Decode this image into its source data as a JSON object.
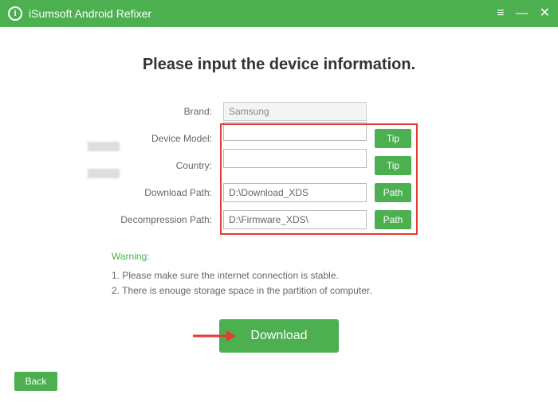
{
  "titlebar": {
    "logo_letter": "i",
    "title": "iSumsoft Android Refixer"
  },
  "heading": "Please input the device information.",
  "form": {
    "brand": {
      "label": "Brand:",
      "value": "Samsung"
    },
    "device_model": {
      "label": "Device Model:",
      "value": "",
      "tip": "Tip"
    },
    "country": {
      "label": "Country:",
      "value": "",
      "tip": "Tip"
    },
    "download_path": {
      "label": "Download Path:",
      "value": "D:\\Download_XDS",
      "btn": "Path"
    },
    "decompression_path": {
      "label": "Decompression Path:",
      "value": "D:\\Firmware_XDS\\",
      "btn": "Path"
    }
  },
  "warning": {
    "title": "Warning:",
    "lines": [
      "1. Please make sure the internet connection is stable.",
      "2. There is enouge storage space in the partition of computer."
    ]
  },
  "download_label": "Download",
  "back_label": "Back"
}
